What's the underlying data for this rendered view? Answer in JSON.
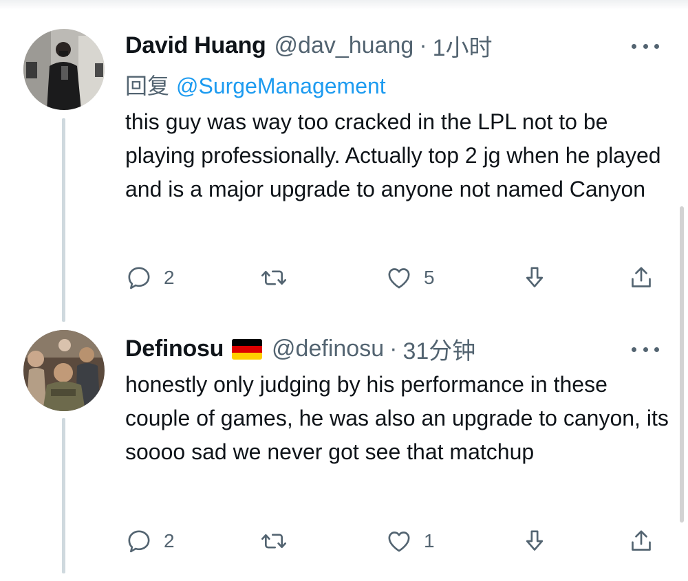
{
  "tweets": [
    {
      "name": "David Huang",
      "handle": "@dav_huang",
      "sep": "·",
      "time": "1小时",
      "reply_label": "回复",
      "reply_to": "@SurgeManagement",
      "text": "this guy was way too cracked in the LPL not to be playing professionally. Actually top 2 jg when he played and is a major upgrade to anyone not named Canyon",
      "replies": "2",
      "retweets": "",
      "likes": "5"
    },
    {
      "name": "Definosu",
      "flag": "germany-flag",
      "handle": "@definosu",
      "sep": "·",
      "time": "31分钟",
      "text": "honestly only judging by his performance in these couple of games, he was also an upgrade to canyon, its soooo sad we never got see that matchup",
      "replies": "2",
      "retweets": "",
      "likes": "1"
    }
  ],
  "icons": {
    "reply": "reply-icon",
    "retweet": "retweet-icon",
    "like": "like-icon",
    "download": "download-icon",
    "share": "share-icon",
    "more": "more-icon"
  },
  "colors": {
    "text": "#0f1419",
    "secondary": "#536471",
    "accent": "#1d9bf0",
    "thread": "#cfd9de"
  }
}
